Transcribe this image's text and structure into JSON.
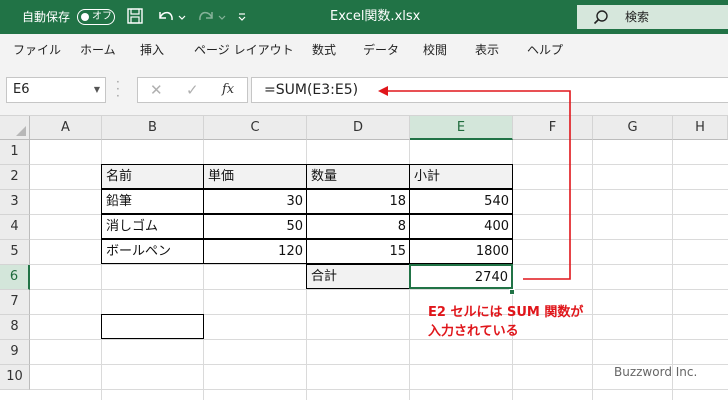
{
  "titlebar": {
    "autosave_label": "自動保存",
    "autosave_state": "オフ",
    "title": "Excel関数.xlsx",
    "search_placeholder": "検索",
    "save_icon": "save-icon",
    "undo_icon": "undo-icon",
    "redo_icon": "redo-icon",
    "customize_icon": "chevron-down-icon"
  },
  "menu": [
    "ファイル",
    "ホーム",
    "挿入",
    "ページ レイアウト",
    "数式",
    "データ",
    "校閲",
    "表示",
    "ヘルプ"
  ],
  "formula_bar": {
    "name_box": "E6",
    "cancel_glyph": "✕",
    "enter_glyph": "✓",
    "fx_label": "fx",
    "formula": "=SUM(E3:E5)"
  },
  "grid": {
    "columns": [
      "A",
      "B",
      "C",
      "D",
      "E",
      "F",
      "G",
      "H"
    ],
    "selected_column": "E",
    "rows": [
      "1",
      "2",
      "3",
      "4",
      "5",
      "6",
      "7",
      "8",
      "9",
      "10"
    ],
    "selected_row": "6"
  },
  "table": {
    "headers": [
      "名前",
      "単価",
      "数量",
      "小計"
    ],
    "rows": [
      {
        "name": "鉛筆",
        "price": "30",
        "qty": "18",
        "subtotal": "540"
      },
      {
        "name": "消しゴム",
        "price": "50",
        "qty": "8",
        "subtotal": "400"
      },
      {
        "name": "ボールペン",
        "price": "120",
        "qty": "15",
        "subtotal": "1800"
      }
    ],
    "total_label": "合計",
    "total_value": "2740"
  },
  "annotation": {
    "line1": "E2 セルには SUM 関数が",
    "line2": "入力されている",
    "color": "#e0161b"
  },
  "credit": "Buzzword Inc.",
  "colors": {
    "excel_green": "#217346",
    "selection_header": "#d3e6da",
    "annotation_red": "#e0161b"
  }
}
